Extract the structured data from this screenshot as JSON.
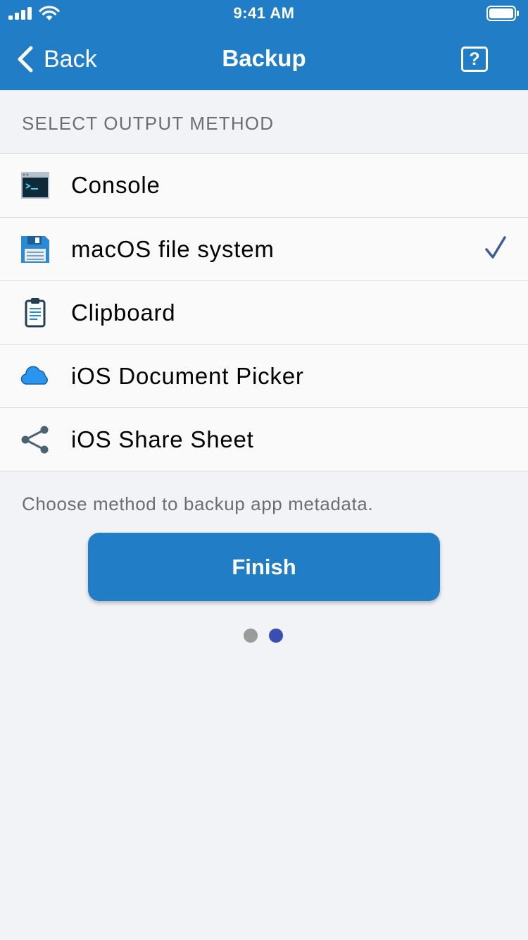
{
  "status_bar": {
    "time": "9:41 AM"
  },
  "nav": {
    "back_label": "Back",
    "title": "Backup",
    "help_label": "?"
  },
  "section": {
    "header": "SELECT OUTPUT METHOD"
  },
  "options": [
    {
      "label": "Console",
      "icon": "terminal-icon",
      "selected": false
    },
    {
      "label": "macOS file system",
      "icon": "floppy-disk-icon",
      "selected": true
    },
    {
      "label": "Clipboard",
      "icon": "clipboard-icon",
      "selected": false
    },
    {
      "label": "iOS Document Picker",
      "icon": "cloud-icon",
      "selected": false
    },
    {
      "label": "iOS Share Sheet",
      "icon": "share-icon",
      "selected": false
    }
  ],
  "footer": {
    "text": "Choose method to backup app metadata."
  },
  "finish_button": {
    "label": "Finish"
  },
  "page_indicator": {
    "total": 2,
    "current": 2
  },
  "colors": {
    "accent": "#217ec6",
    "background": "#f2f3f7",
    "check": "#3d5f8f",
    "dot_active": "#3b4db3",
    "dot_inactive": "#9b9b9b"
  }
}
